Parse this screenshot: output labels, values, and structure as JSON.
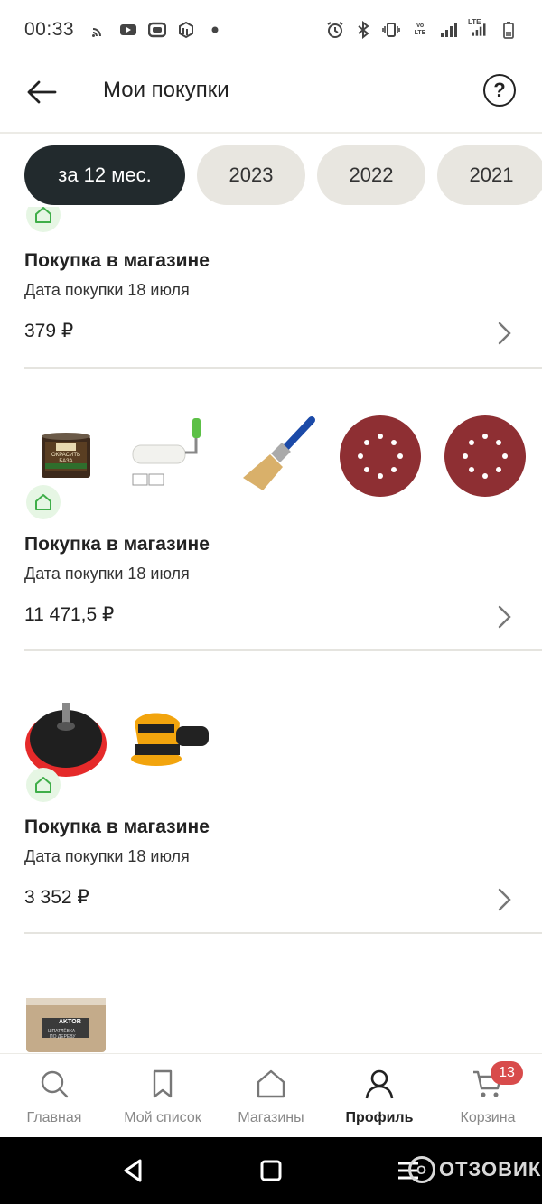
{
  "status_bar": {
    "time": "00:33",
    "left_icons": [
      "cast-icon",
      "youtube-icon",
      "app-icon",
      "box-icon",
      "dot-icon"
    ],
    "right_icons": [
      "alarm-icon",
      "bluetooth-icon",
      "vibrate-icon",
      "volte-icon",
      "signal-icon",
      "lte-signal-icon",
      "battery-icon"
    ],
    "volte_text": "Vo LTE",
    "lte_text": "LTE"
  },
  "header": {
    "title": "Мои покупки",
    "back_icon": "arrow-left-icon",
    "help_label": "?"
  },
  "filters": [
    {
      "label": "за 12 мес.",
      "active": true
    },
    {
      "label": "2023",
      "active": false
    },
    {
      "label": "2022",
      "active": false
    },
    {
      "label": "2021",
      "active": false
    }
  ],
  "purchases": [
    {
      "title": "Покупка в магазине",
      "date": "Дата покупки 18 июля",
      "price": "379 ₽",
      "thumbnails": []
    },
    {
      "title": "Покупка в магазине",
      "date": "Дата покупки 18 июля",
      "price": "11 471,5 ₽",
      "thumbnails": [
        "paint-can",
        "paint-roller",
        "paint-brush",
        "sanding-disc",
        "sanding-disc"
      ]
    },
    {
      "title": "Покупка в магазине",
      "date": "Дата покупки 18 июля",
      "price": "3 352 ₽",
      "thumbnails": [
        "sanding-pad",
        "orbital-sander"
      ]
    },
    {
      "title": "",
      "date": "",
      "price": "",
      "thumbnails": [
        "putty-bucket"
      ]
    }
  ],
  "thumb_text": {
    "paint_can": "ОКРАСИТЬ БАЗА",
    "bucket_brand": "AKTOR",
    "bucket_line1": "ШПАТЛЁВКА",
    "bucket_line2": "ПО ДЕРЕВУ"
  },
  "bottom_nav": [
    {
      "label": "Главная",
      "icon": "search-icon",
      "active": false
    },
    {
      "label": "Мой список",
      "icon": "bookmark-icon",
      "active": false
    },
    {
      "label": "Магазины",
      "icon": "house-icon",
      "active": false
    },
    {
      "label": "Профиль",
      "icon": "user-icon",
      "active": true
    },
    {
      "label": "Корзина",
      "icon": "cart-icon",
      "active": false,
      "badge": "13"
    }
  ],
  "watermark": {
    "text": "ОТЗОВИК",
    "circle": "O"
  },
  "colors": {
    "accent_dark": "#222a2d",
    "chip_bg": "#e8e6e0",
    "badge_red": "#d84b4b",
    "store_badge_bg": "#e6f6e4",
    "store_green": "#3fae49"
  }
}
